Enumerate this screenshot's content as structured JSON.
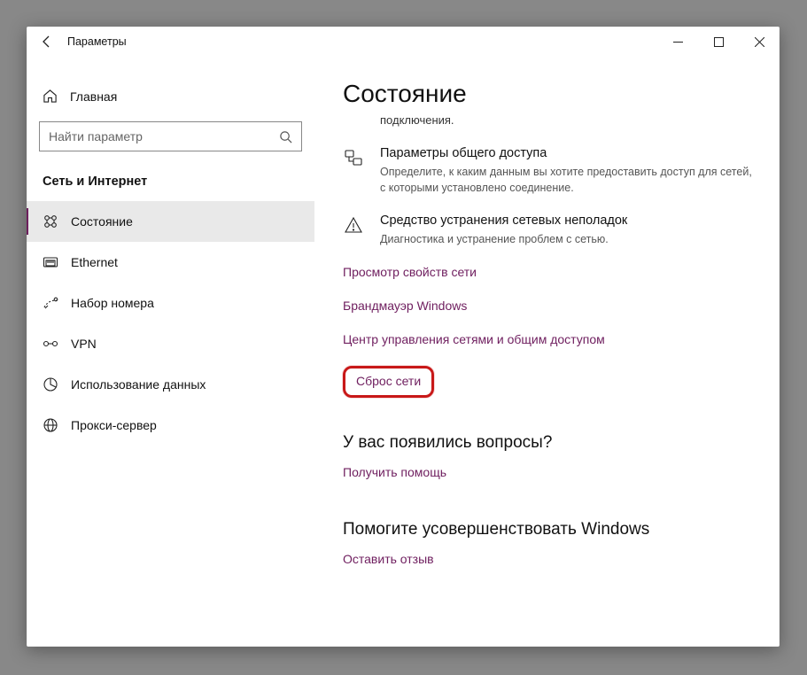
{
  "titlebar": {
    "title": "Параметры"
  },
  "sidebar": {
    "home_label": "Главная",
    "search_placeholder": "Найти параметр",
    "section_label": "Сеть и Интернет",
    "items": [
      {
        "label": "Состояние",
        "icon": "status-icon",
        "active": true
      },
      {
        "label": "Ethernet",
        "icon": "ethernet-icon",
        "active": false
      },
      {
        "label": "Набор номера",
        "icon": "dialup-icon",
        "active": false
      },
      {
        "label": "VPN",
        "icon": "vpn-icon",
        "active": false
      },
      {
        "label": "Использование данных",
        "icon": "datausage-icon",
        "active": false
      },
      {
        "label": "Прокси-сервер",
        "icon": "proxy-icon",
        "active": false
      }
    ]
  },
  "content": {
    "heading": "Состояние",
    "subtext": "подключения.",
    "blocks": [
      {
        "title": "Параметры общего доступа",
        "desc": "Определите, к каким данным вы хотите предоставить доступ для сетей, с которыми установлено соединение."
      },
      {
        "title": "Средство устранения сетевых неполадок",
        "desc": "Диагностика и устранение проблем с сетью."
      }
    ],
    "links": [
      "Просмотр свойств сети",
      "Брандмауэр Windows",
      "Центр управления сетями и общим доступом"
    ],
    "highlighted_link": "Сброс сети",
    "help": {
      "heading": "У вас появились вопросы?",
      "link": "Получить помощь"
    },
    "feedback": {
      "heading": "Помогите усовершенствовать Windows",
      "link": "Оставить отзыв"
    }
  }
}
